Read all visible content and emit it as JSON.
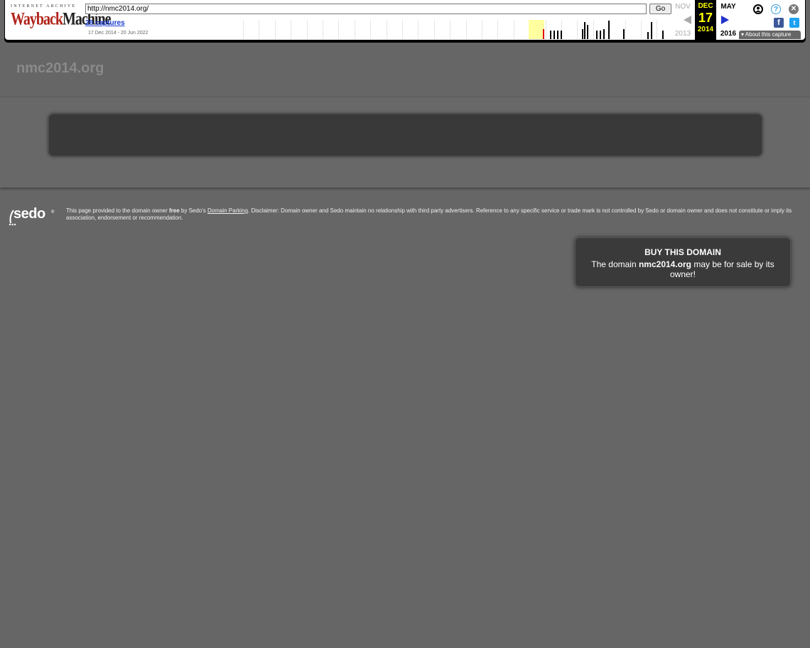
{
  "wayback": {
    "logo_top": "INTERNET ARCHIVE",
    "logo_main_a": "Wayback",
    "logo_main_b": "Machine",
    "url_value": "http://nmc2014.org/",
    "go_label": "Go",
    "captures_label": "26 captures",
    "date_range": "17 Dec 2014 - 20 Jun 2022",
    "prev_month": "NOV",
    "cur_month": "DEC",
    "next_month": "MAY",
    "cur_day": "17",
    "prev_year": "2013",
    "cur_year": "2014",
    "next_year": "2016",
    "about_label": "About this capture",
    "icons": [
      "user-icon",
      "help-icon",
      "close-icon",
      "facebook-icon",
      "twitter-icon",
      "prev-arrow-icon",
      "next-arrow-icon"
    ]
  },
  "site": {
    "title": "nmc2014.org"
  },
  "footer": {
    "sedo_logo": "sedo",
    "disclaimer_a": "This page provided to the domain owner ",
    "disclaimer_free": "free",
    "disclaimer_b": " by Sedo's ",
    "disclaimer_link": "Domain Parking",
    "disclaimer_c": ". Disclaimer: Domain owner and Sedo maintain no relationship with third party advertisers. Reference to any specific service or trade mark is not controlled by Sedo or domain owner and does not constitute or imply its association, endorsement or recommendation."
  },
  "buy_box": {
    "title": "BUY THIS DOMAIN",
    "text_a": "The domain ",
    "domain": "nmc2014.org",
    "text_b": " may be for sale by its owner!"
  },
  "colors": {
    "page_bg": "#666666",
    "box_bg": "#393939",
    "wayback_red": "#b0231a",
    "wayback_highlight": "#ffff00"
  }
}
